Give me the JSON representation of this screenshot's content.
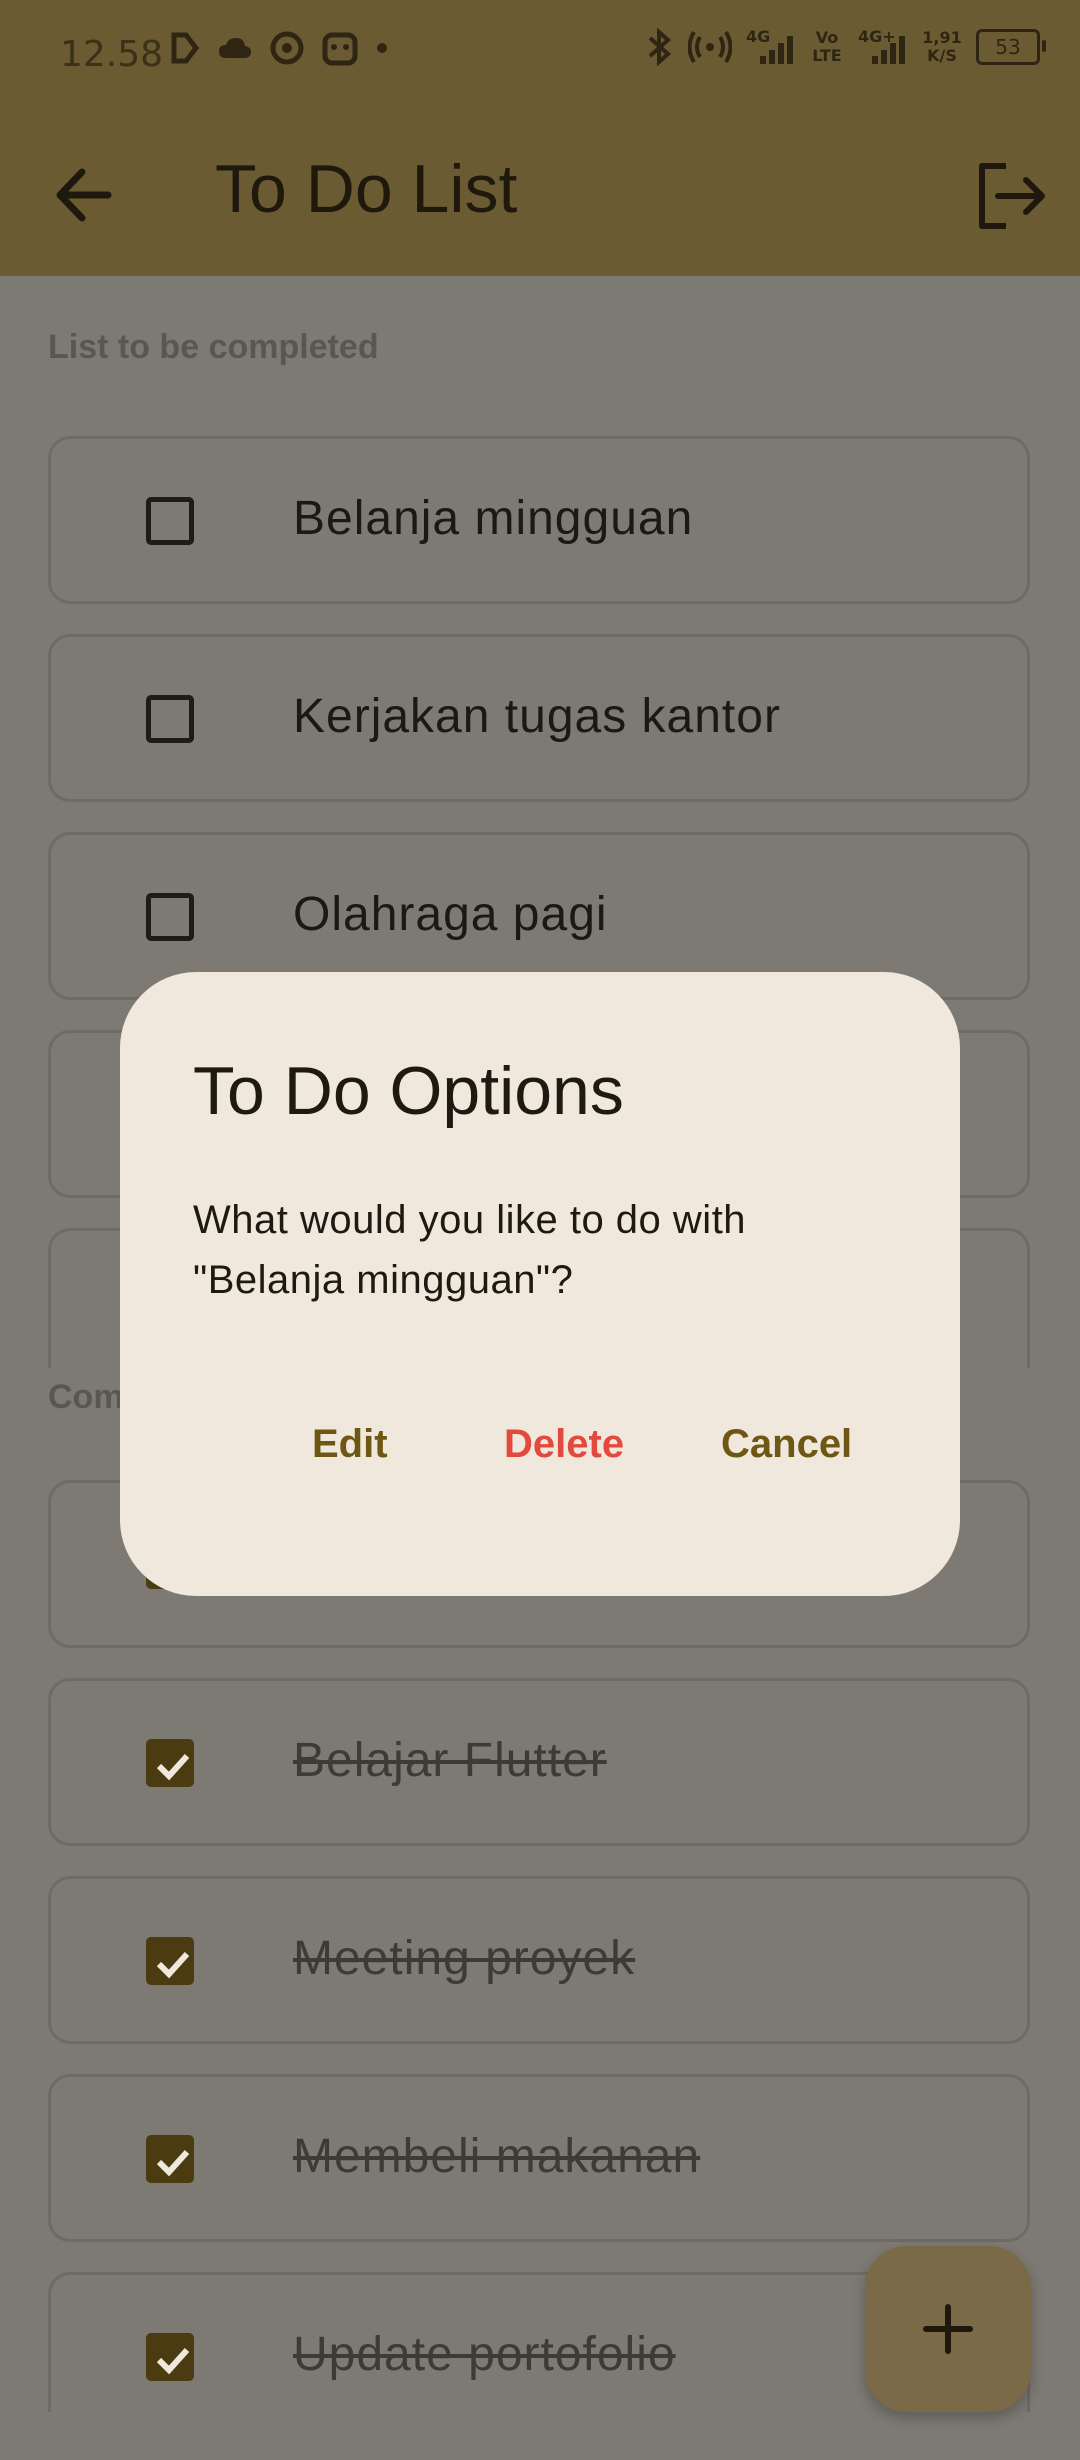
{
  "status_bar": {
    "time": "12.58",
    "network_1": "4G",
    "volte": "Vo LTE",
    "network_2": "4G+",
    "speed_value": "1,91",
    "speed_unit": "K/S",
    "battery": "53"
  },
  "app_bar": {
    "title": "To Do List",
    "back_icon": "arrow-back-icon",
    "logout_icon": "logout-icon"
  },
  "sections": {
    "pending_title": "List to be completed",
    "completed_title": "Com"
  },
  "pending_items": [
    {
      "label": "Belanja mingguan",
      "checked": false
    },
    {
      "label": "Kerjakan tugas kantor",
      "checked": false
    },
    {
      "label": "Olahraga pagi",
      "checked": false
    },
    {
      "label": "",
      "checked": false
    },
    {
      "label": "",
      "checked": false
    }
  ],
  "completed_items": [
    {
      "label": "",
      "checked": true
    },
    {
      "label": "Belajar Flutter",
      "checked": true
    },
    {
      "label": "Meeting proyek",
      "checked": true
    },
    {
      "label": "Membeli makanan",
      "checked": true
    },
    {
      "label": "Update portofolio",
      "checked": true
    }
  ],
  "dialog": {
    "title": "To Do Options",
    "message": "What would you like to do with \"Belanja mingguan\"?",
    "edit_label": "Edit",
    "delete_label": "Delete",
    "cancel_label": "Cancel"
  },
  "fab": {
    "icon": "plus-icon"
  },
  "colors": {
    "app_bar": "#6b5b32",
    "scrim_background": "#7d7a73",
    "dialog_background": "#f0e8dc",
    "accent": "#6e5714",
    "delete": "#e4493d"
  }
}
